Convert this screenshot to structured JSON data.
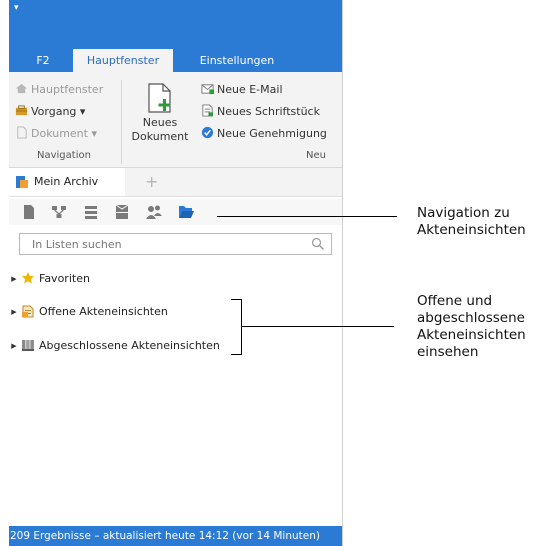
{
  "ribbon_tabs": [
    "F2",
    "Hauptfenster",
    "Einstellungen"
  ],
  "ribbon": {
    "navigation_items": [
      "Hauptfenster",
      "Vorgang ▾",
      "Dokument ▾"
    ],
    "navigation_group_label": "Navigation",
    "new_document_label_line1": "Neues",
    "new_document_label_line2": "Dokument",
    "new_items": [
      "Neue E-Mail",
      "Neues Schriftstück",
      "Neue Genehmigung"
    ],
    "new_group_label": "Neu"
  },
  "doc_tabs": {
    "active_label": "Mein Archiv",
    "add_label": "+"
  },
  "toolbar_icons": [
    "document-icon",
    "network-icon",
    "list-icon",
    "email-stack-icon",
    "people-icon",
    "folder-open-icon"
  ],
  "search": {
    "placeholder": "In Listen suchen"
  },
  "tree": [
    {
      "label": "Favoriten",
      "icon": "star-icon"
    },
    {
      "label": "Offene Akteneinsichten",
      "icon": "open-files-icon"
    },
    {
      "label": "Abgeschlossene Akteneinsichten",
      "icon": "closed-files-icon"
    }
  ],
  "status_bar": "209 Ergebnisse – aktualisiert heute 14:12 (vor 14 Minuten)",
  "annotations": {
    "nav": [
      "Navigation zu",
      "Akteneinsichten"
    ],
    "open_closed": [
      "Offene und",
      "abgeschlossene",
      "Akteneinsichten",
      "einsehen"
    ]
  },
  "colors": {
    "accent": "#2b7bd4",
    "star": "#f0b400",
    "icon_blue": "#2b7bd4",
    "icon_gray": "#7a7a7a"
  }
}
